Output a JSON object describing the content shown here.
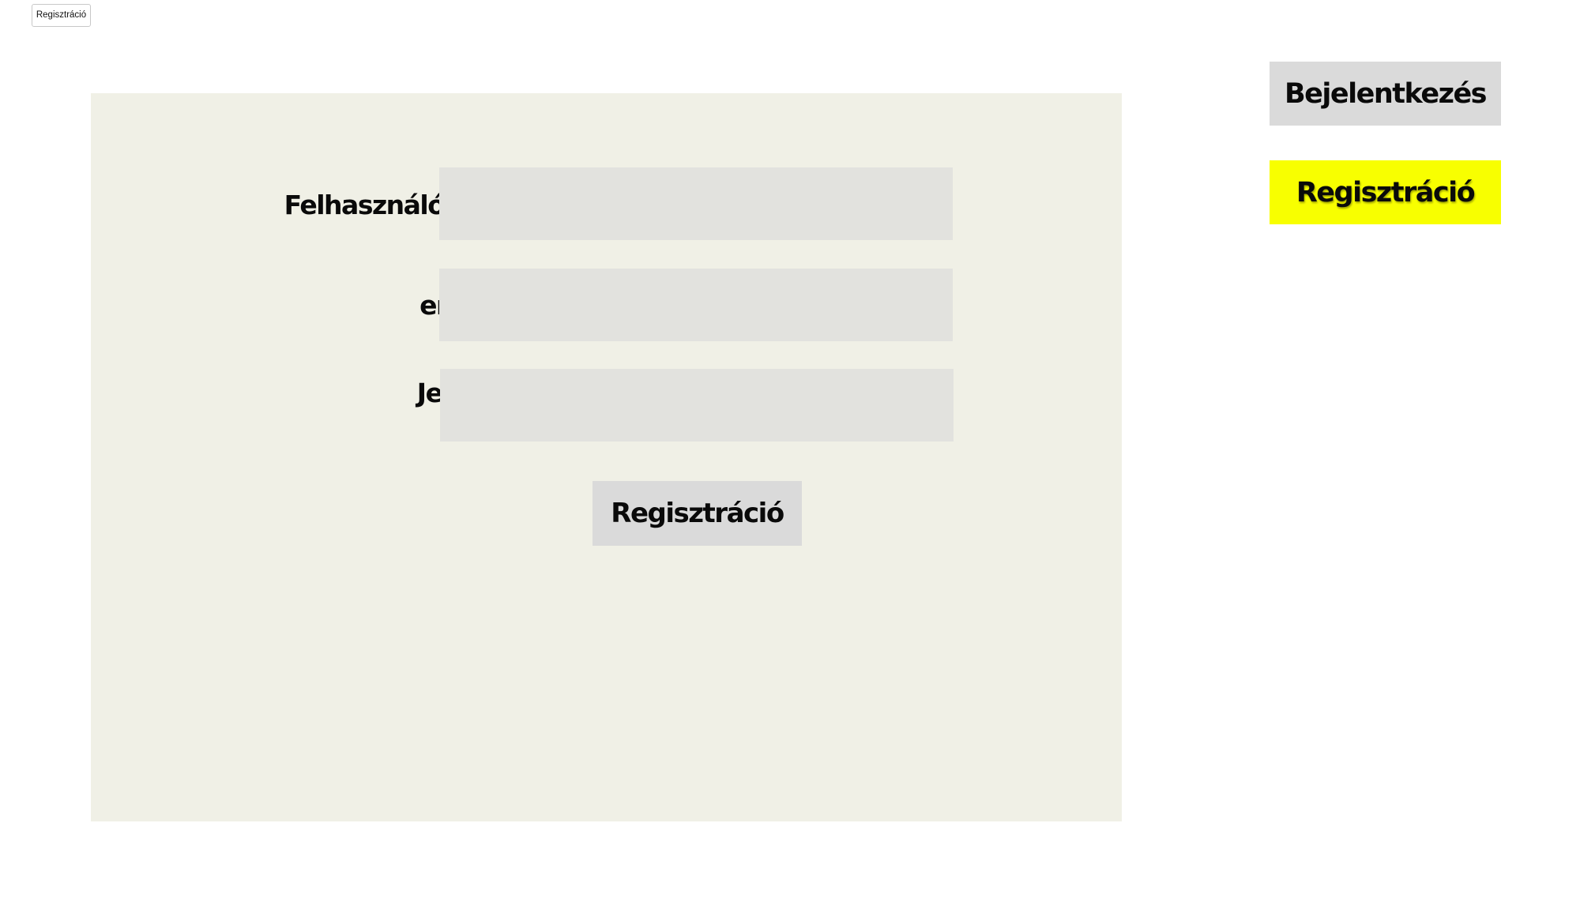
{
  "tab": {
    "label": "Regisztráció"
  },
  "form": {
    "username_label": "Felhasználónév:",
    "username_value": "",
    "email_label": "email:",
    "email_value": "",
    "password_label": "Jelszó:",
    "password_value": "",
    "submit_label": "Regisztráció"
  },
  "nav": {
    "login_label": "Bejelentkezés",
    "register_label": "Regisztráció"
  },
  "colors": {
    "panel_background": "#f0f0e6",
    "field_background": "#e2e2de",
    "button_gray": "#dadada",
    "active_highlight": "#f8ff00"
  }
}
